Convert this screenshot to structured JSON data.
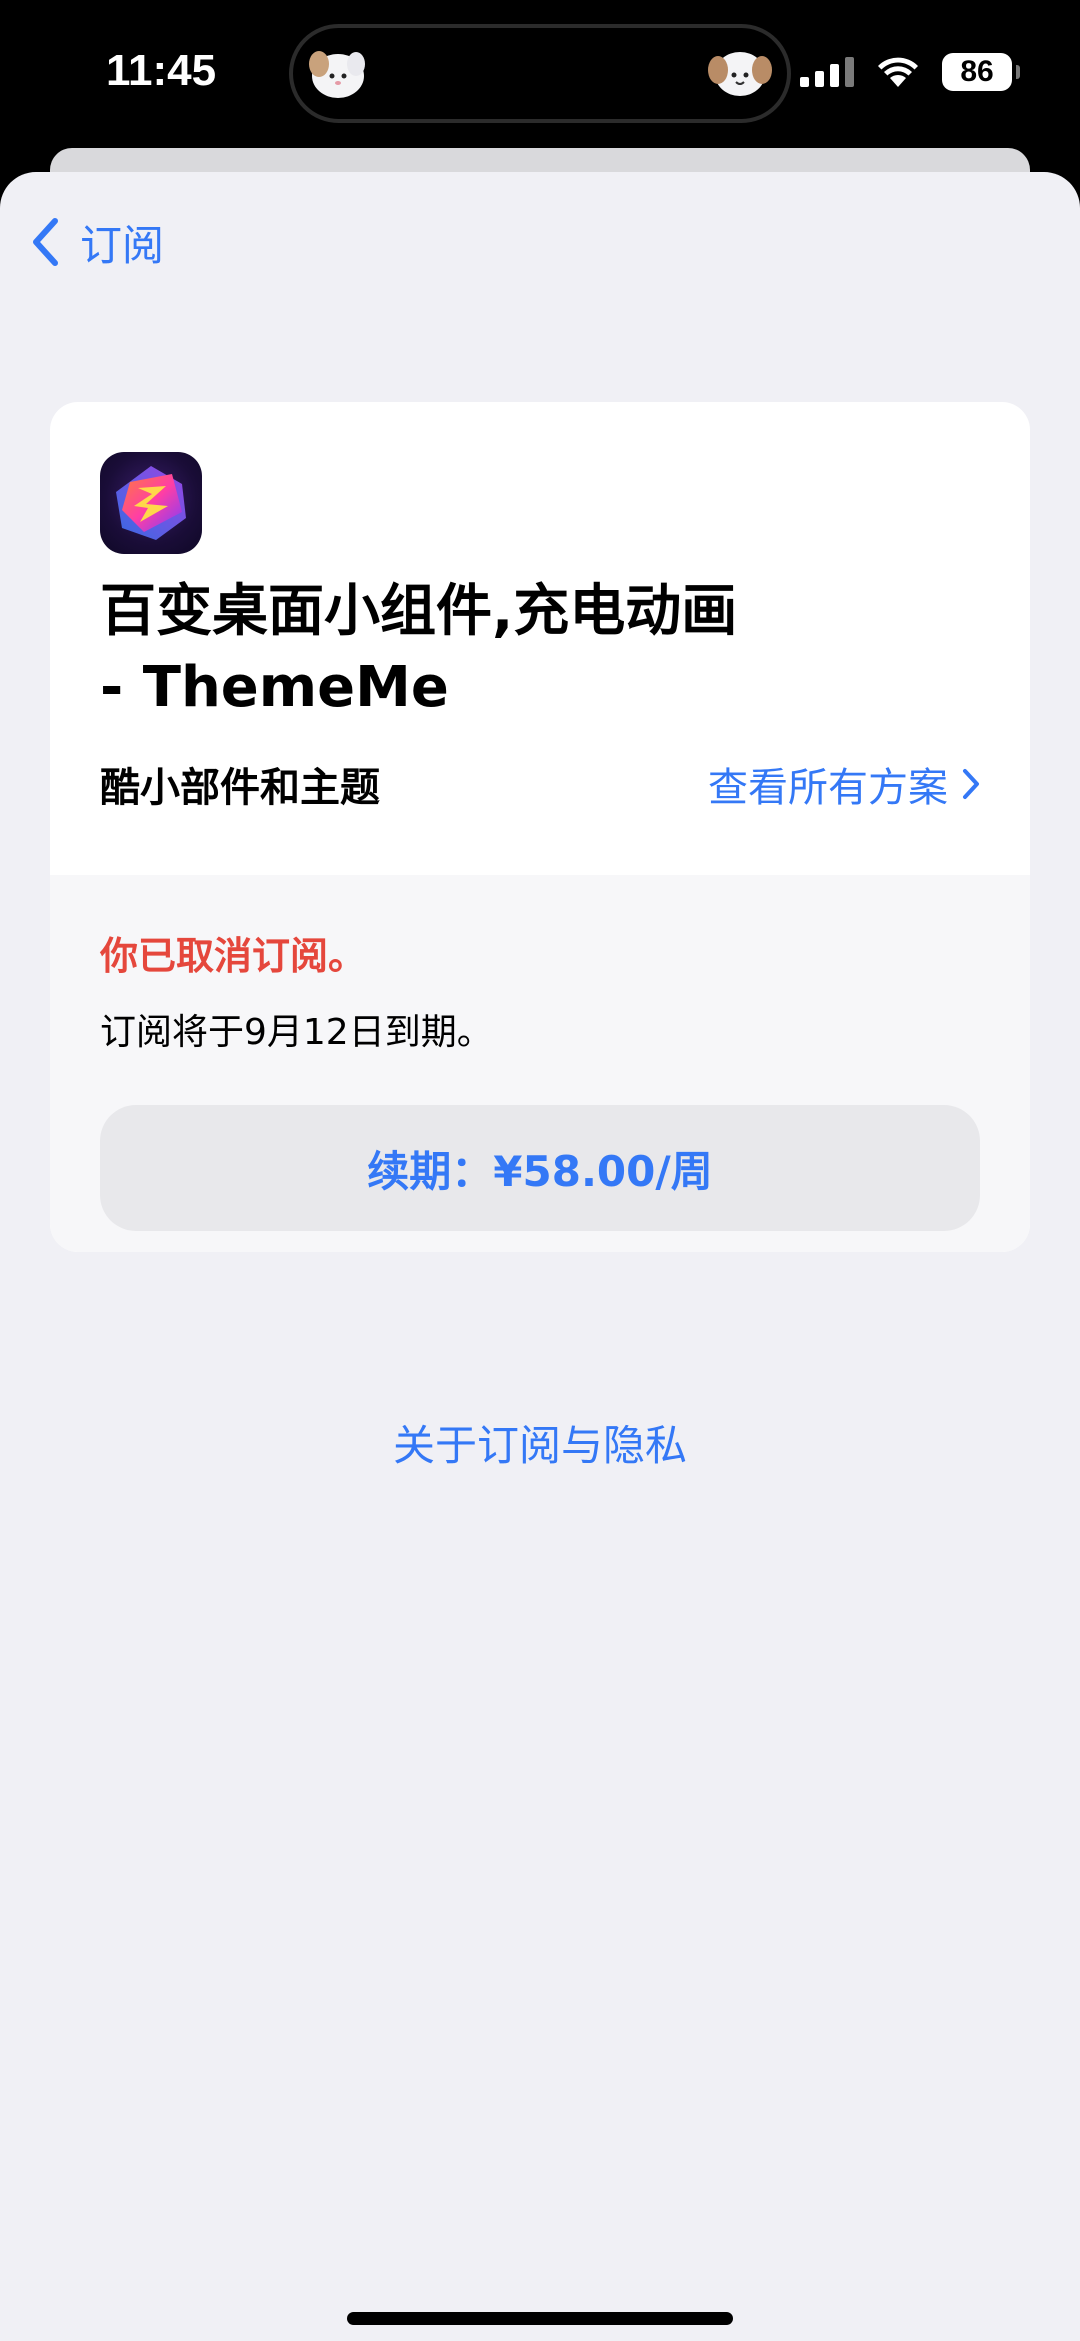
{
  "status_bar": {
    "time": "11:45",
    "battery": "86",
    "icons": [
      "cellular-signal-icon",
      "wifi-icon",
      "battery-icon"
    ]
  },
  "nav": {
    "back_label": "订阅",
    "back_icon": "chevron-left-icon"
  },
  "subscription": {
    "app_title_line1": "百变桌面小组件,充电动画",
    "app_title_line2": "- ThemeMe",
    "plan_name": "酷小部件和主题",
    "see_all_plans": "查看所有方案",
    "cancelled_notice": "你已取消订阅。",
    "expiry_text": "订阅将于9月12日到期。",
    "renew_button": "续期：¥58.00/周"
  },
  "footer": {
    "privacy_link": "关于订阅与隐私"
  },
  "colors": {
    "accent": "#3478f6",
    "warning": "#e5473c",
    "background": "#f0f0f5",
    "card": "#ffffff"
  }
}
